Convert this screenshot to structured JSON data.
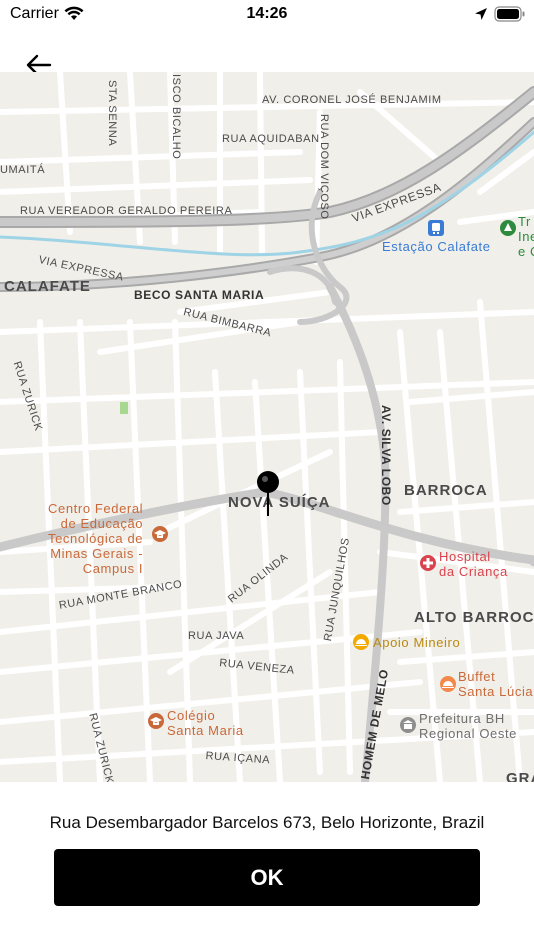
{
  "status_bar": {
    "carrier": "Carrier",
    "time": "14:26"
  },
  "map": {
    "districts": [
      "CALAFATE",
      "NOVA SUÍÇA",
      "BARROCA",
      "ALTO BARROCA",
      "GRA"
    ],
    "streets": {
      "senna": "STA SENNA",
      "bicalho": "ISCO BICALHO",
      "coronel": "AV. CORONEL JOSÉ BENJAMIM",
      "aquidaban": "RUA AQUIDABAN",
      "vicoso": "RUA DOM VIÇOSO",
      "umaita": "UMAITÁ",
      "geraldo": "RUA VEREADOR GERALDO PEREIRA",
      "via_expressa_1": "VIA EXPRESSA",
      "via_expressa_2": "VIA EXPRESSA",
      "beco": "BECO SANTA MARIA",
      "bimbarra": "RUA BIMBARRA",
      "zurick_1": "RUA ZURICK",
      "silva_lobo": "AV. SILVA LOBO",
      "monte_branco": "RUA MONTE BRANCO",
      "olinda": "RUA OLINDA",
      "junquilhos": "RUA JUNQUILHOS",
      "java": "RUA JAVA",
      "veneza": "RUA VENEZA",
      "homem_melo": "HOMEM DE MELO",
      "zurick_2": "RUA ZURICK",
      "icana": "RUA IÇANA"
    },
    "pois": {
      "estacao": "Estação Calafate",
      "tr": "Tr\nIne\ne C",
      "cefet": "Centro Federal\nde Educação\nTecnológica de\nMinas Gerais -\nCampus I",
      "hospital": "Hospital\nda Criança",
      "apoio": "Apoio Mineiro",
      "buffet": "Buffet\nSanta Lúcia",
      "prefeitura": "Prefeitura BH\nRegional Oeste",
      "colegio": "Colégio\nSanta Maria"
    }
  },
  "address": "Rua Desembargador Barcelos 673, Belo Horizonte, Brazil",
  "ok_label": "OK"
}
